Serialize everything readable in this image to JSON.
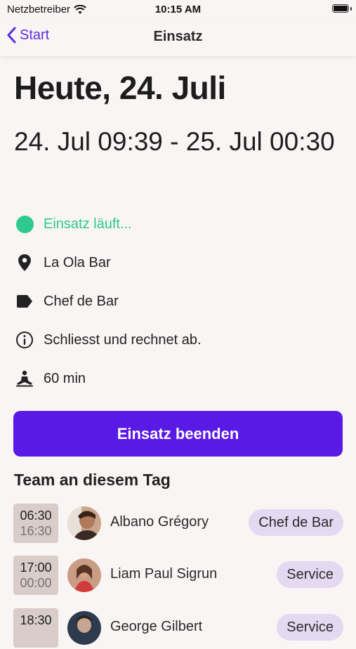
{
  "status_bar": {
    "carrier": "Netzbetreiber",
    "time": "10:15 AM"
  },
  "nav": {
    "back_label": "Start",
    "title": "Einsatz"
  },
  "heading": "Heute, 24. Juli",
  "timerange": "24. Jul 09:39 - 25. Jul 00:30",
  "status_text": "Einsatz läuft...",
  "location": "La Ola Bar",
  "role": "Chef de Bar",
  "note": "Schliesst und rechnet ab.",
  "break": "60 min",
  "end_button": "Einsatz beenden",
  "team_title": "Team an diesem Tag",
  "team": [
    {
      "start": "06:30",
      "end": "16:30",
      "name": "Albano Grégory",
      "role": "Chef de Bar"
    },
    {
      "start": "17:00",
      "end": "00:00",
      "name": "Liam Paul Sigrun",
      "role": "Service"
    },
    {
      "start": "18:30",
      "end": "",
      "name": "George Gilbert",
      "role": "Service"
    }
  ],
  "colors": {
    "accent": "#5a1ae6",
    "status_green": "#2ec98e",
    "pill": "#e5d9f2"
  },
  "icons": [
    "wifi-icon",
    "battery-icon",
    "chevron-left-icon",
    "location-pin-icon",
    "tag-icon",
    "info-icon",
    "break-person-icon"
  ]
}
